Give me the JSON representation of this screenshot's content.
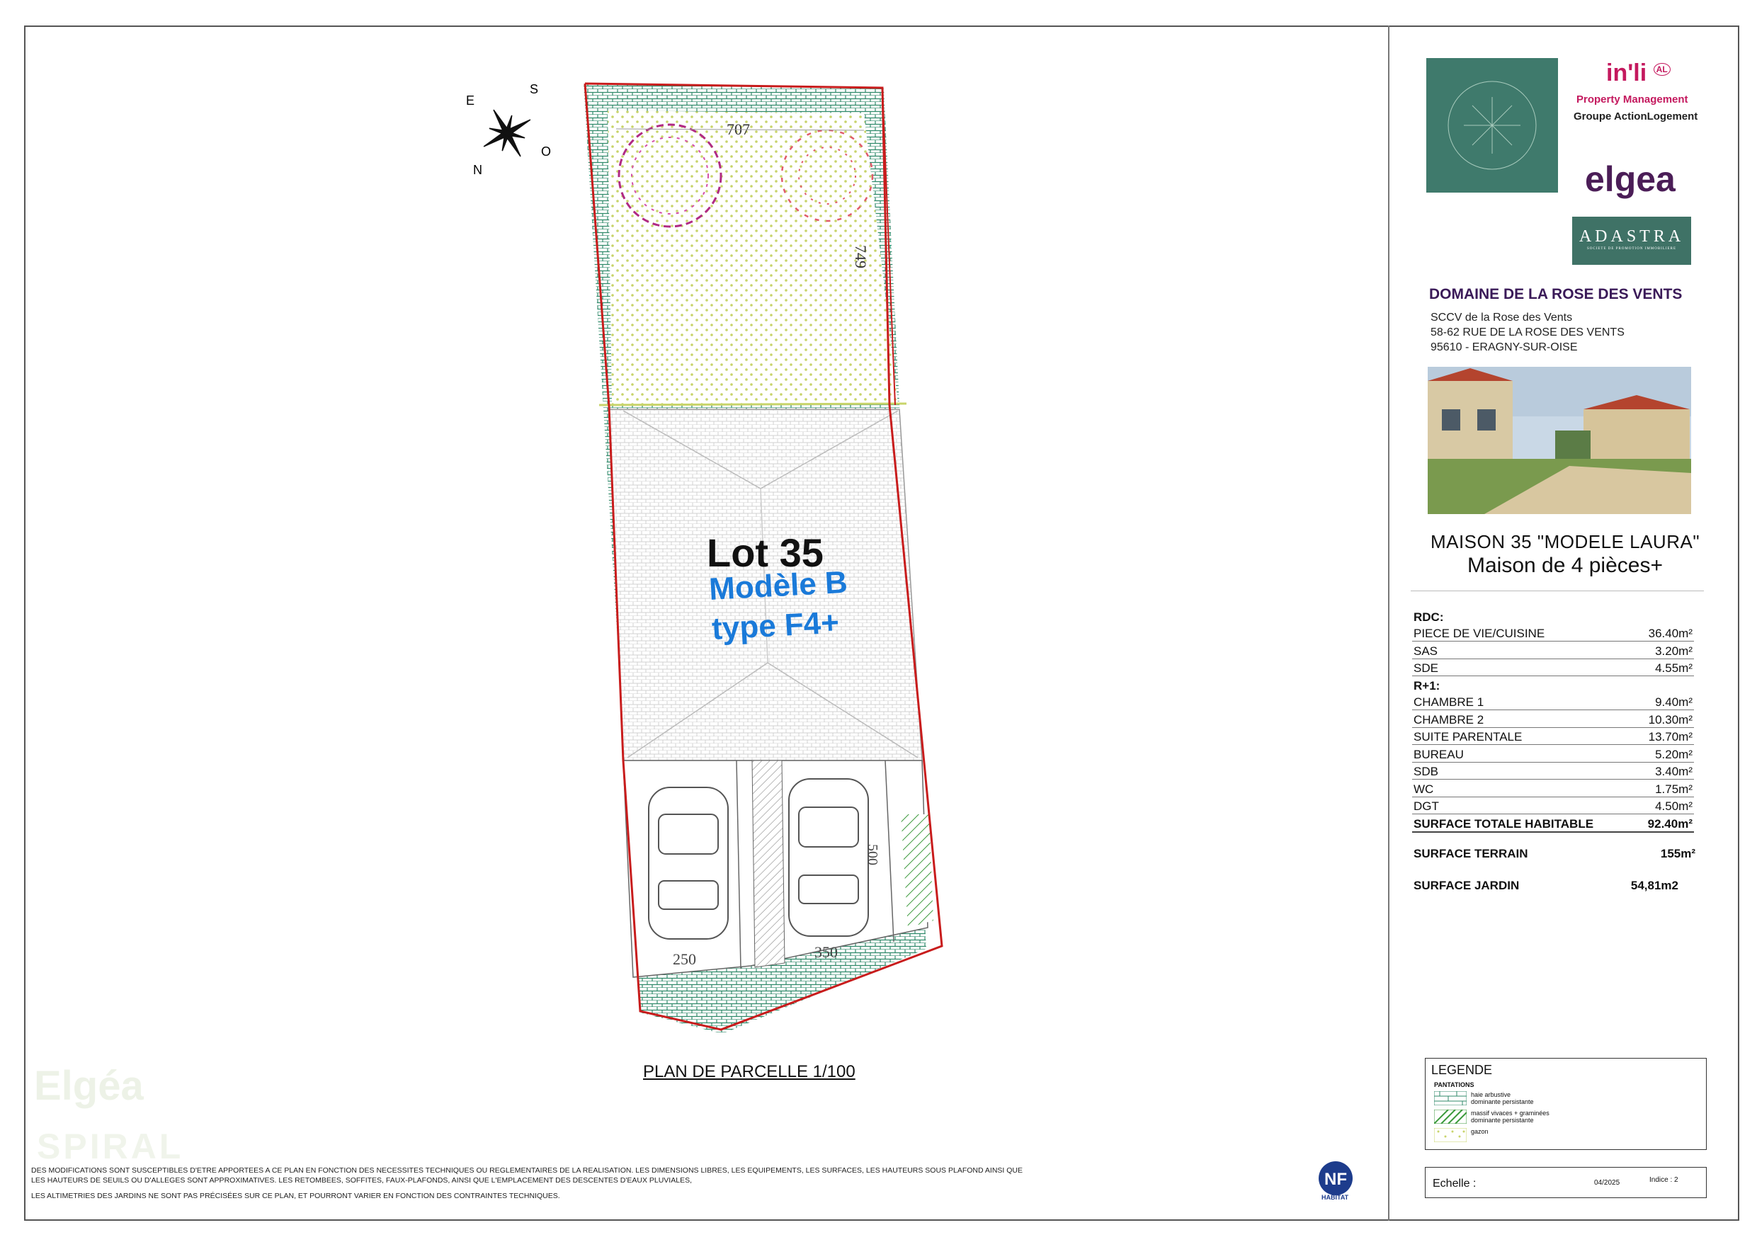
{
  "plan": {
    "compass": {
      "n": "N",
      "s": "S",
      "e": "E",
      "o": "O"
    },
    "dimensions": {
      "top_width": "707",
      "garden_depth": "749",
      "parking_left": "250",
      "parking_right": "350",
      "parking_depth": "500"
    },
    "lot_title": "Lot 35",
    "lot_model": "Modèle B",
    "lot_type": "type F4+",
    "caption": "PLAN DE PARCELLE 1/100"
  },
  "disclaimer": [
    "Des modifications sont susceptibles d'etre apportees a ce plan en fonction des necessites techniques ou reglementaires de la realisation. Les dimensions libres, les equipements, les surfaces, les hauteurs sous plafond ainsi que les hauteurs de seuils ou d'alleges sont approximatives. Les retombees, soffites, faux-plafonds, ainsi que l'emplacement des descentes d'eaux pluviales,",
    "Les altimetries des jardins ne sont pas précisées sur ce plan, et pourront varier en fonction des contraintes techniques."
  ],
  "watermarks": {
    "line1": "Elgéa",
    "line2": "SPIRAL"
  },
  "nf_logo": {
    "label": "HABITAT",
    "mark": "NF"
  },
  "logos": {
    "domaine_text": "DOMAINE DE LA ROSE DES VENTS",
    "inli": "in'li",
    "inli_badge": "AL",
    "inli_sub": "Property Management",
    "inli_group": "Groupe ActionLogement",
    "elgea": "elgea",
    "adastra": "ADASTRA",
    "adastra_tagline": "SOCIETE DE PROMOTION IMMOBILIERE",
    "colors": {
      "domaine": "#3f7a6c",
      "inli": "#c4195e",
      "elgea": "#4b1d57",
      "adastra": "#3f7266"
    }
  },
  "project": {
    "title": "DOMAINE DE LA ROSE DES VENTS",
    "address_line1": "SCCV de la Rose des Vents",
    "address_line2": "58-62 RUE DE LA ROSE DES VENTS",
    "address_line3": "95610 - ERAGNY-SUR-OISE"
  },
  "house": {
    "line1": "MAISON 35 \"MODELE LAURA\"",
    "line2": "Maison de 4 pièces+"
  },
  "areas": {
    "rdc_label": "RDC:",
    "rdc": [
      {
        "room": "PIECE DE VIE/CUISINE",
        "area": "36.40m²"
      },
      {
        "room": "SAS",
        "area": "3.20m²"
      },
      {
        "room": "SDE",
        "area": "4.55m²"
      }
    ],
    "r1_label": "R+1:",
    "r1": [
      {
        "room": "CHAMBRE 1",
        "area": "9.40m²"
      },
      {
        "room": "CHAMBRE 2",
        "area": "10.30m²"
      },
      {
        "room": "SUITE PARENTALE",
        "area": "13.70m²"
      },
      {
        "room": "BUREAU",
        "area": "5.20m²"
      },
      {
        "room": "SDB",
        "area": "3.40m²"
      },
      {
        "room": "WC",
        "area": "1.75m²"
      },
      {
        "room": "DGT",
        "area": "4.50m²"
      }
    ],
    "total_label": "SURFACE TOTALE HABITABLE",
    "total": "92.40m²",
    "terrain_label": "SURFACE TERRAIN",
    "terrain": "155m²",
    "jardin_label": "SURFACE JARDIN",
    "jardin": "54,81m2"
  },
  "legend": {
    "title": "LEGENDE",
    "subtitle": "PANTATIONS",
    "items": [
      {
        "line1": "haie arbustive",
        "line2": "dominante persistante"
      },
      {
        "line1": "massif vivaces + graminées",
        "line2": "dominante persistante"
      },
      {
        "line1": "gazon",
        "line2": ""
      }
    ]
  },
  "footer_box": {
    "scale_label": "Echelle :",
    "date": "04/2025",
    "index": "Indice : 2"
  }
}
